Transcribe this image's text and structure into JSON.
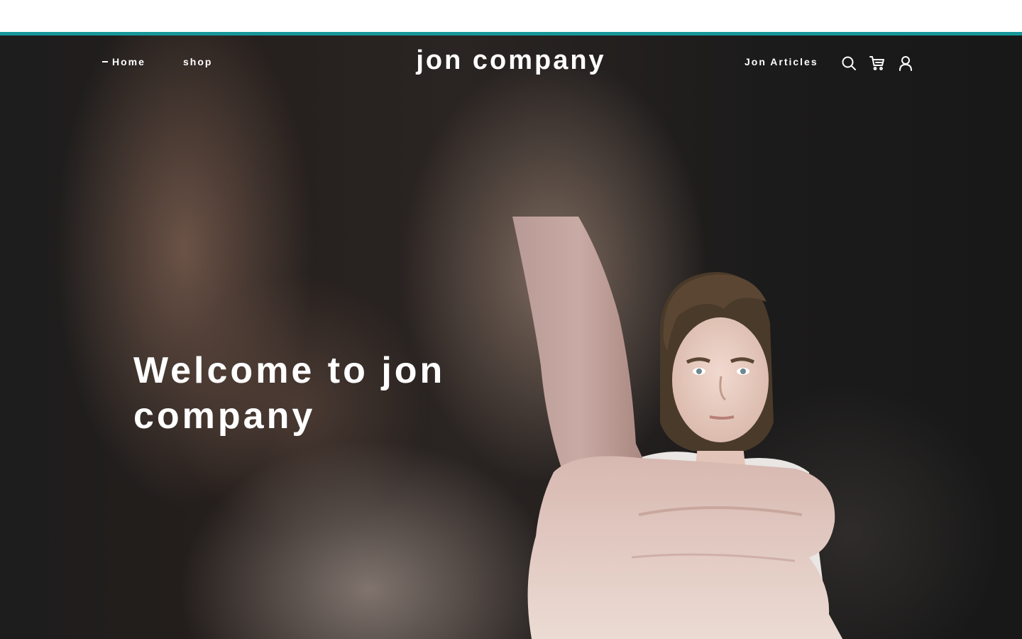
{
  "colors": {
    "accent": "#16979a",
    "page_bg": "#1a1a1a",
    "text": "#ffffff"
  },
  "header": {
    "site_title": "jon company",
    "nav_left": [
      {
        "label": "Home",
        "active": true
      },
      {
        "label": "shop",
        "active": false
      }
    ],
    "nav_right": {
      "label": "Jon Articles"
    },
    "icons": [
      "search-icon",
      "cart-icon",
      "account-icon"
    ]
  },
  "hero": {
    "title": "Welcome to jon company",
    "image": "person-thumbs-up"
  }
}
